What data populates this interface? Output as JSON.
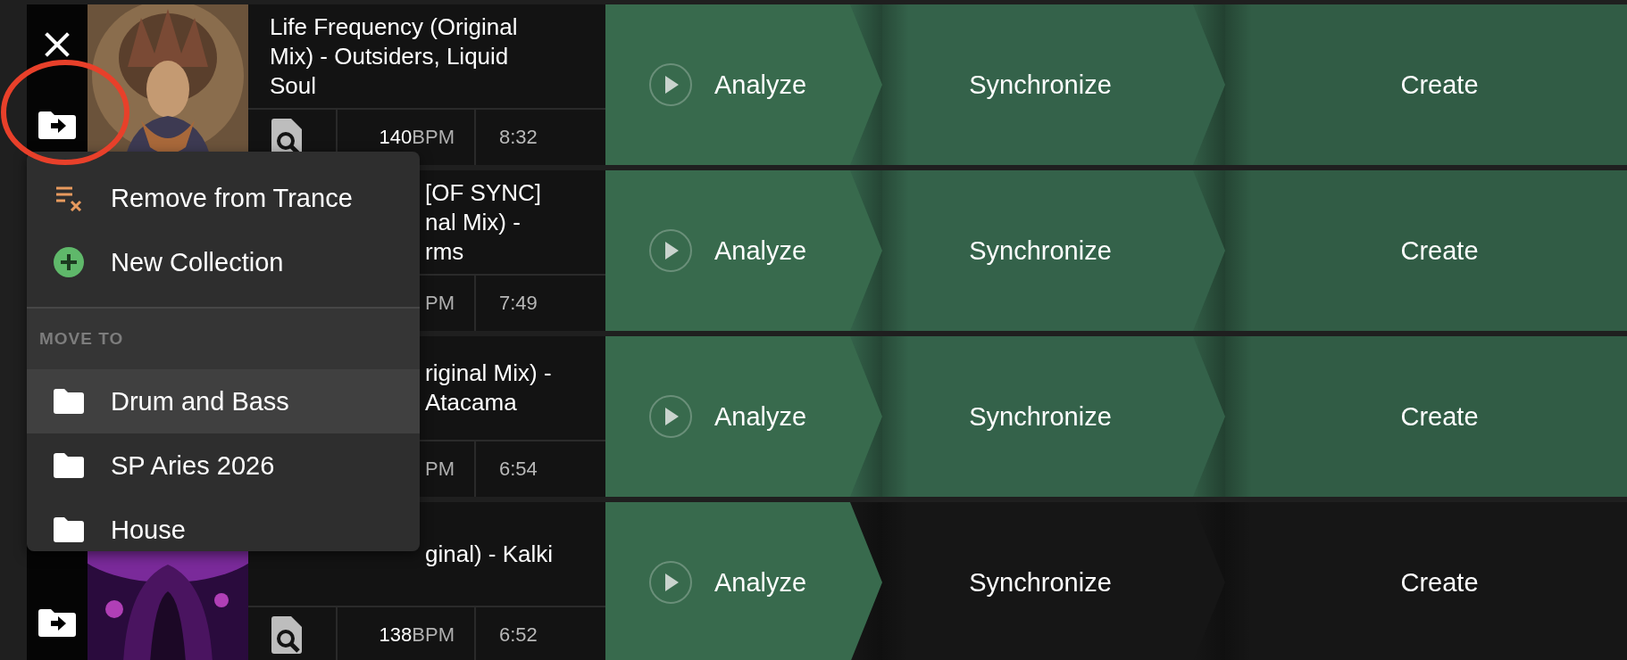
{
  "tracks": [
    {
      "close_button": true,
      "move_button": true,
      "cover": {
        "kind": "picture"
      },
      "title_lines": [
        "Life Frequency (Original",
        "Mix) - Outsiders, Liquid",
        "Soul"
      ],
      "partly_covered": false,
      "analysis_icon": true,
      "bpm_value": "140",
      "bpm_unit": "BPM",
      "duration": "8:32",
      "steps": [
        {
          "label": "Analyze",
          "kind": "play",
          "done": true
        },
        {
          "label": "Synchronize",
          "kind": "plain",
          "done": true
        },
        {
          "label": "Create",
          "kind": "plain",
          "done": true
        }
      ]
    },
    {
      "title_lines": [
        "[OF SYNC]",
        "nal Mix) -",
        "rms"
      ],
      "partly_covered": true,
      "analysis_icon": false,
      "bpm_unit": "PM",
      "duration": "7:49",
      "steps": [
        {
          "label": "Analyze",
          "kind": "play",
          "done": true
        },
        {
          "label": "Synchronize",
          "kind": "plain",
          "done": true
        },
        {
          "label": "Create",
          "kind": "plain",
          "done": true
        }
      ]
    },
    {
      "title_lines": [
        "riginal Mix) -",
        "Atacama"
      ],
      "partly_covered": true,
      "analysis_icon": false,
      "bpm_unit": "PM",
      "duration": "6:54",
      "steps": [
        {
          "label": "Analyze",
          "kind": "play",
          "done": true
        },
        {
          "label": "Synchronize",
          "kind": "plain",
          "done": true
        },
        {
          "label": "Create",
          "kind": "plain",
          "done": true
        }
      ]
    },
    {
      "move_button": true,
      "cover": {
        "kind": "picture"
      },
      "title_lines": [
        "ginal) - Kalki"
      ],
      "partly_covered": true,
      "analysis_icon": true,
      "bpm_value": "138",
      "bpm_unit": "BPM",
      "duration": "6:52",
      "steps": [
        {
          "label": "Analyze",
          "kind": "play",
          "done": true
        },
        {
          "label": "Synchronize",
          "kind": "plain",
          "done": false
        },
        {
          "label": "Create",
          "kind": "plain",
          "done": false
        }
      ]
    }
  ],
  "menu": {
    "actions": [
      {
        "label": "Remove from Trance",
        "kind": "remove"
      },
      {
        "label": "New Collection",
        "kind": "add"
      }
    ],
    "section_title": "MOVE TO",
    "collections": [
      {
        "label": "Drum and Bass",
        "selected": true
      },
      {
        "label": "SP Aries 2026",
        "selected": false
      },
      {
        "label": "House",
        "selected": false
      }
    ]
  },
  "highlight_ring": true
}
